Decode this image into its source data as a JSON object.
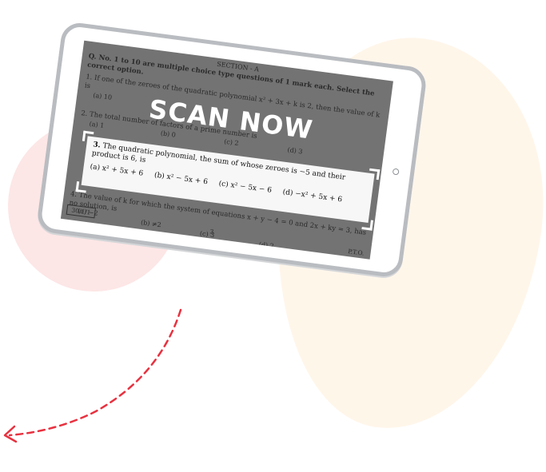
{
  "scan_label": "SCAN NOW",
  "exam": {
    "section": "SECTION - A",
    "instructions": "Q. No. 1 to 10 are multiple choice type questions of 1 mark each. Select the correct option.",
    "q1": "1.  If one of the zeroes of the quadratic polynomial x² + 3x + k is 2, then the value of k is",
    "q1_opt_a": "(a) 10",
    "q2": "2.  The total number of factors of a prime number is",
    "q2_opts": [
      "(a) 1",
      "(b) 0",
      "(c) 2",
      "(d) 3"
    ],
    "q3": {
      "number": "3.",
      "text": "The quadratic polynomial, the sum of whose zeroes is −5 and their product is 6, is",
      "options": [
        "(a) x² + 5x + 6",
        "(b) x² − 5x + 6",
        "(c) x² − 5x − 6",
        "(d) −x² + 5x + 6"
      ]
    },
    "q4": "4.  The value of k for which the system of equations x + y − 4 = 0 and 2x + ky = 3, has no solution, is",
    "q4_opts": [
      "(a) −2",
      "(b) ≠2",
      "(c) 3",
      "(d) 2"
    ],
    "code": "30/1/1",
    "page_number": "3",
    "pto": "P.T.O."
  },
  "colors": {
    "accent_red": "#e8313f",
    "screen_overlay": "#737373",
    "blob_cream": "#fff6ea",
    "blob_pink": "#fde6e6"
  },
  "icons": [
    "dashed-curved-arrow-icon",
    "home-button-icon"
  ]
}
